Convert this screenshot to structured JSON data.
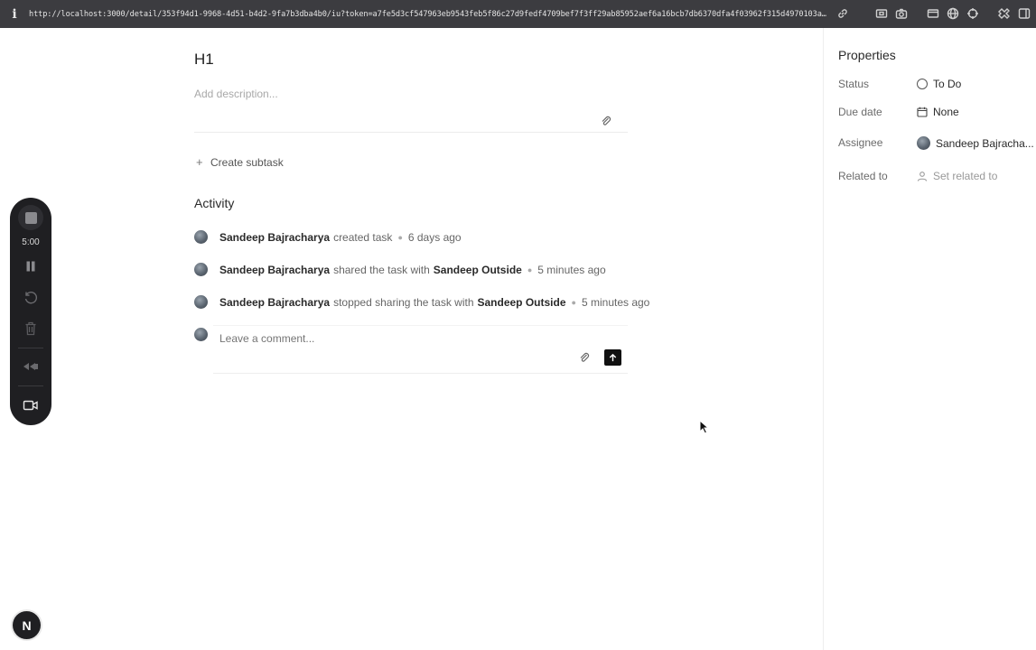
{
  "browser": {
    "url": "http://localhost:3000/detail/353f94d1-9968-4d51-b4d2-9fa7b3dba4b0/iu?token=a7fe5d3cf547963eb9543feb5f86c27d9fedf4709bef7f3ff29ab85952aef6a16bcb7db6370dfa4f03962f315d4970103a…"
  },
  "task": {
    "title": "H1",
    "description_placeholder": "Add description...",
    "create_subtask_label": "Create subtask"
  },
  "activity": {
    "heading": "Activity",
    "items": [
      {
        "actor": "Sandeep Bajracharya",
        "action": "created task",
        "target": "",
        "time": "6 days ago"
      },
      {
        "actor": "Sandeep Bajracharya",
        "action": "shared the task with",
        "target": "Sandeep Outside",
        "time": "5 minutes ago"
      },
      {
        "actor": "Sandeep Bajracharya",
        "action": "stopped sharing the task with",
        "target": "Sandeep Outside",
        "time": "5 minutes ago"
      }
    ],
    "comment_placeholder": "Leave a comment..."
  },
  "recorder": {
    "time": "5:00"
  },
  "badge": {
    "letter": "N"
  },
  "properties": {
    "heading": "Properties",
    "status_label": "Status",
    "status_value": "To Do",
    "due_label": "Due date",
    "due_value": "None",
    "assignee_label": "Assignee",
    "assignee_value": "Sandeep Bajracha...",
    "related_label": "Related to",
    "related_value": "Set related to"
  }
}
